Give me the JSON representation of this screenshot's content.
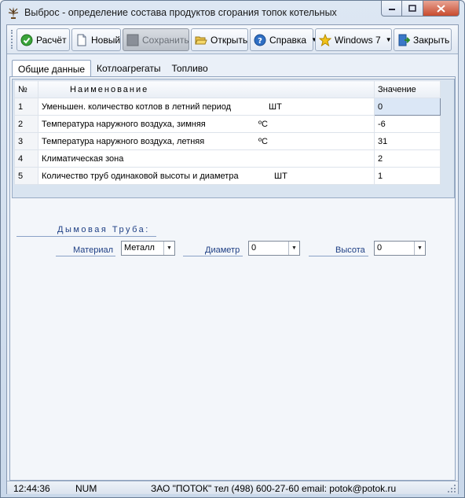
{
  "window": {
    "title": "Выброс - определение состава продуктов сгорания топок котельных"
  },
  "toolbar": {
    "calc": "Расчёт",
    "new": "Новый",
    "save": "Сохранить",
    "open": "Открыть",
    "help": "Справка",
    "theme": "Windows 7",
    "close": "Закрыть"
  },
  "tabs": [
    "Общие данные",
    "Котлоагрегаты",
    "Топливо"
  ],
  "grid": {
    "headers": {
      "num": "№",
      "name": "Наименование",
      "value": "Значение"
    },
    "rows": [
      {
        "num": "1",
        "name": "Уменьшен. количество котлов в летний период",
        "unit": "ШТ",
        "value": "0"
      },
      {
        "num": "2",
        "name": "Температура наружного воздуха, зимняя",
        "unit": "ºC",
        "value": "-6"
      },
      {
        "num": "3",
        "name": "Температура наружного воздуха, летняя",
        "unit": "ºC",
        "value": "31"
      },
      {
        "num": "4",
        "name": "Климатическая зона",
        "unit": "",
        "value": "2"
      },
      {
        "num": "5",
        "name": "Количество  труб одинаковой высоты и диаметра",
        "unit": "ШТ",
        "value": "1"
      }
    ]
  },
  "chimney": {
    "title": "Дымовая Труба:",
    "material_label": "Материал",
    "material_value": "Металл",
    "diameter_label": "Диаметр",
    "diameter_value": "0",
    "height_label": "Высота",
    "height_value": "0"
  },
  "status": {
    "time": "12:44:36",
    "num": "NUM",
    "company": "ЗАО \"ПОТОК\" тел (498) 600-27-60  email: potok@potok.ru"
  }
}
